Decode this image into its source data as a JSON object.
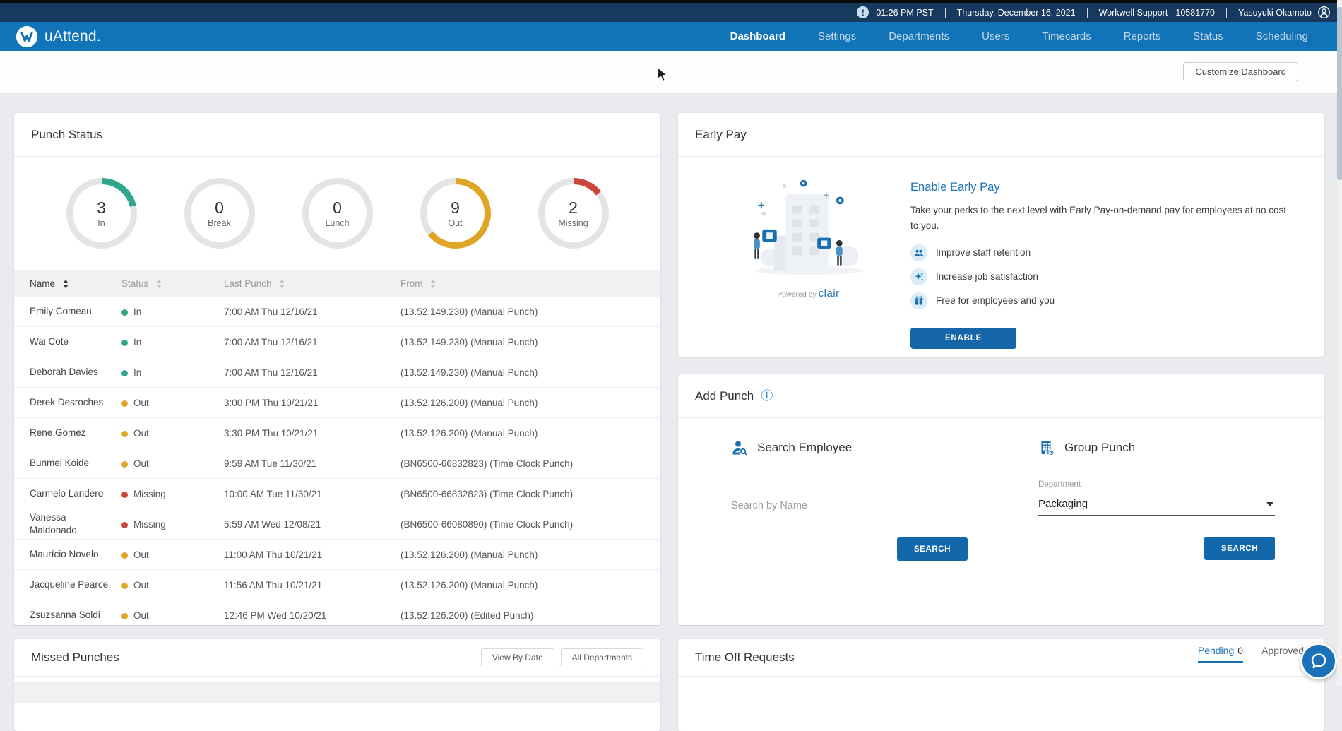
{
  "colors": {
    "navy": "#17395e",
    "nav_blue": "#1173b8",
    "accent": "#1a73b8",
    "teal": "#2fa58c",
    "amber": "#dfa524",
    "red": "#c9463d",
    "ring_gray": "#e4e4e4"
  },
  "top_bar": {
    "time": "01:26 PM PST",
    "date": "Thursday, December 16, 2021",
    "account": "Workwell Support - 10581770",
    "user": "Yasuyuki Okamoto"
  },
  "brand": {
    "name": "uAttend."
  },
  "nav": {
    "items": [
      {
        "label": "Dashboard",
        "active": true
      },
      {
        "label": "Settings",
        "active": false
      },
      {
        "label": "Departments",
        "active": false
      },
      {
        "label": "Users",
        "active": false
      },
      {
        "label": "Timecards",
        "active": false
      },
      {
        "label": "Reports",
        "active": false
      },
      {
        "label": "Status",
        "active": false
      },
      {
        "label": "Scheduling",
        "active": false
      }
    ]
  },
  "toolbar": {
    "customize_label": "Customize Dashboard"
  },
  "punch_status": {
    "title": "Punch Status",
    "donuts": [
      {
        "value": "3",
        "label": "In",
        "color": "#2fa58c"
      },
      {
        "value": "0",
        "label": "Break",
        "color": "#2fa58c"
      },
      {
        "value": "0",
        "label": "Lunch",
        "color": "#2fa58c"
      },
      {
        "value": "9",
        "label": "Out",
        "color": "#dfa524"
      },
      {
        "value": "2",
        "label": "Missing",
        "color": "#c9463d"
      }
    ],
    "table": {
      "headers": [
        "Name",
        "Status",
        "Last Punch",
        "From"
      ],
      "status_colors": {
        "In": "#2fa58c",
        "Out": "#dfa524",
        "Missing": "#c9463d"
      },
      "rows": [
        {
          "name": "Emily Comeau",
          "status": "In",
          "last_punch": "7:00 AM Thu 12/16/21",
          "from": "(13.52.149.230) (Manual Punch)"
        },
        {
          "name": "Wai Cote",
          "status": "In",
          "last_punch": "7:00 AM Thu 12/16/21",
          "from": "(13.52.149.230) (Manual Punch)"
        },
        {
          "name": "Deborah Davies",
          "status": "In",
          "last_punch": "7:00 AM Thu 12/16/21",
          "from": "(13.52.149.230) (Manual Punch)"
        },
        {
          "name": "Derek Desroches",
          "status": "Out",
          "last_punch": "3:00 PM Thu 10/21/21",
          "from": "(13.52.126.200) (Manual Punch)"
        },
        {
          "name": "Rene Gomez",
          "status": "Out",
          "last_punch": "3:30 PM Thu 10/21/21",
          "from": "(13.52.126.200) (Manual Punch)"
        },
        {
          "name": "Bunmei Koide",
          "status": "Out",
          "last_punch": "9:59 AM Tue 11/30/21",
          "from": "(BN6500-66832823) (Time Clock Punch)"
        },
        {
          "name": "Carmelo Landero",
          "status": "Missing",
          "last_punch": "10:00 AM Tue 11/30/21",
          "from": "(BN6500-66832823) (Time Clock Punch)"
        },
        {
          "name": "Vanessa Maldonado",
          "status": "Missing",
          "last_punch": "5:59 AM Wed 12/08/21",
          "from": "(BN6500-66080890) (Time Clock Punch)"
        },
        {
          "name": "Maurício Novelo",
          "status": "Out",
          "last_punch": "11:00 AM Thu 10/21/21",
          "from": "(13.52.126.200) (Manual Punch)"
        },
        {
          "name": "Jacqueline Pearce",
          "status": "Out",
          "last_punch": "11:56 AM Thu 10/21/21",
          "from": "(13.52.126.200) (Manual Punch)"
        },
        {
          "name": "Zsuzsanna Soldi",
          "status": "Out",
          "last_punch": "12:46 PM Wed 10/20/21",
          "from": "(13.52.126.200) (Edited Punch)"
        }
      ]
    }
  },
  "early_pay": {
    "title": "Early Pay",
    "heading": "Enable Early Pay",
    "body": "Take your perks to the next level with Early Pay-on-demand pay for employees at no cost to you.",
    "bullets": [
      {
        "icon": "people-icon",
        "label": "Improve staff retention"
      },
      {
        "icon": "sparkle-icon",
        "label": "Increase job satisfaction"
      },
      {
        "icon": "gift-icon",
        "label": "Free for employees and you"
      }
    ],
    "button": "ENABLE",
    "powered_by": "Powered by",
    "powered_brand": "clair"
  },
  "add_punch": {
    "title": "Add Punch",
    "search_employee": {
      "heading": "Search Employee",
      "placeholder": "Search by Name",
      "button": "SEARCH"
    },
    "group_punch": {
      "heading": "Group Punch",
      "department_label": "Department",
      "department_value": "Packaging",
      "button": "SEARCH"
    }
  },
  "missed_punches": {
    "title": "Missed Punches",
    "view_by_date": "View By Date",
    "all_departments": "All Departments"
  },
  "time_off": {
    "title": "Time Off Requests",
    "tabs": [
      {
        "label": "Pending",
        "count": "0",
        "active": true
      },
      {
        "label": "Approved",
        "count": "",
        "active": false
      }
    ]
  }
}
